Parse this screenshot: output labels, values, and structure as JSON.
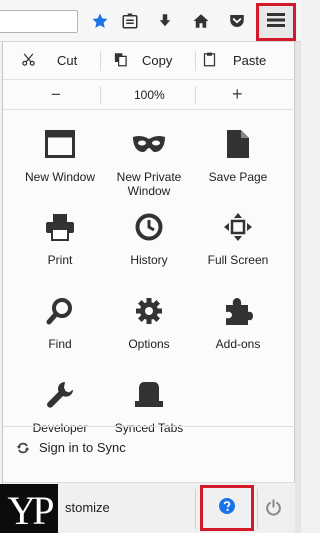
{
  "toolbar": {
    "icons": [
      "star-icon",
      "reading-list-icon",
      "download-icon",
      "home-icon",
      "pocket-icon",
      "hamburger-menu-icon"
    ],
    "accent_star": "#1a73e8",
    "highlight": "#d21a2a"
  },
  "edit": {
    "cut": "Cut",
    "copy": "Copy",
    "paste": "Paste"
  },
  "zoom": {
    "minus": "−",
    "level": "100%",
    "plus": "+"
  },
  "tiles": [
    {
      "label": "New Window",
      "icon": "window-icon"
    },
    {
      "label": "New Private\nWindow",
      "icon": "mask-icon"
    },
    {
      "label": "Save Page",
      "icon": "page-icon"
    },
    {
      "label": "Print",
      "icon": "printer-icon"
    },
    {
      "label": "History",
      "icon": "clock-icon"
    },
    {
      "label": "Full Screen",
      "icon": "fullscreen-icon"
    },
    {
      "label": "Find",
      "icon": "magnifier-icon"
    },
    {
      "label": "Options",
      "icon": "gear-icon"
    },
    {
      "label": "Add-ons",
      "icon": "puzzle-icon"
    },
    {
      "label": "Developer",
      "icon": "wrench-icon"
    },
    {
      "label": "Synced Tabs",
      "icon": "synced-tabs-icon"
    }
  ],
  "sync": {
    "label": "Sign in to Sync"
  },
  "bottom": {
    "customize": "stomize",
    "help_color": "#1a73e8"
  },
  "logo": {
    "text": "YP"
  }
}
